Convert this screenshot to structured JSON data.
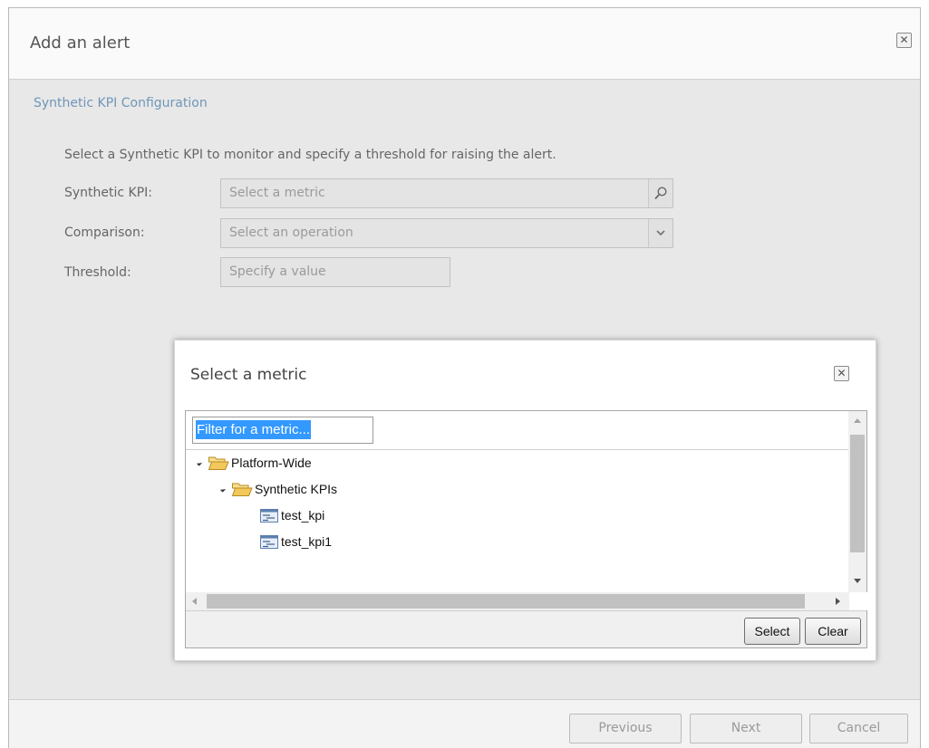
{
  "dialog": {
    "title": "Add an alert",
    "close_icon": "close-x-icon",
    "section_title": "Synthetic KPI Configuration",
    "instruction": "Select a Synthetic KPI to monitor and specify a threshold for raising the alert.",
    "fields": {
      "kpi": {
        "label": "Synthetic KPI:",
        "placeholder": "Select a metric",
        "icon": "search-icon"
      },
      "comparison": {
        "label": "Comparison:",
        "placeholder": "Select an operation",
        "icon": "chevron-down-icon"
      },
      "threshold": {
        "label": "Threshold:",
        "placeholder": "Specify a value"
      }
    },
    "footer": {
      "previous": "Previous",
      "next": "Next",
      "cancel": "Cancel"
    }
  },
  "modal": {
    "title": "Select a metric",
    "close_icon": "close-x-icon",
    "filter": {
      "value": "Filter for a metric..."
    },
    "tree": {
      "root": {
        "label": "Platform-Wide",
        "icon": "folder-open-icon",
        "expanded": true
      },
      "group": {
        "label": "Synthetic KPIs",
        "icon": "folder-open-icon",
        "expanded": true
      },
      "items": [
        {
          "label": "test_kpi",
          "icon": "metric-icon"
        },
        {
          "label": "test_kpi1",
          "icon": "metric-icon"
        }
      ]
    },
    "buttons": {
      "select": "Select",
      "clear": "Clear"
    }
  },
  "colors": {
    "section_title": "#6f96b8",
    "filter_selection": "#3399ff",
    "folder": "#f2c85c"
  }
}
